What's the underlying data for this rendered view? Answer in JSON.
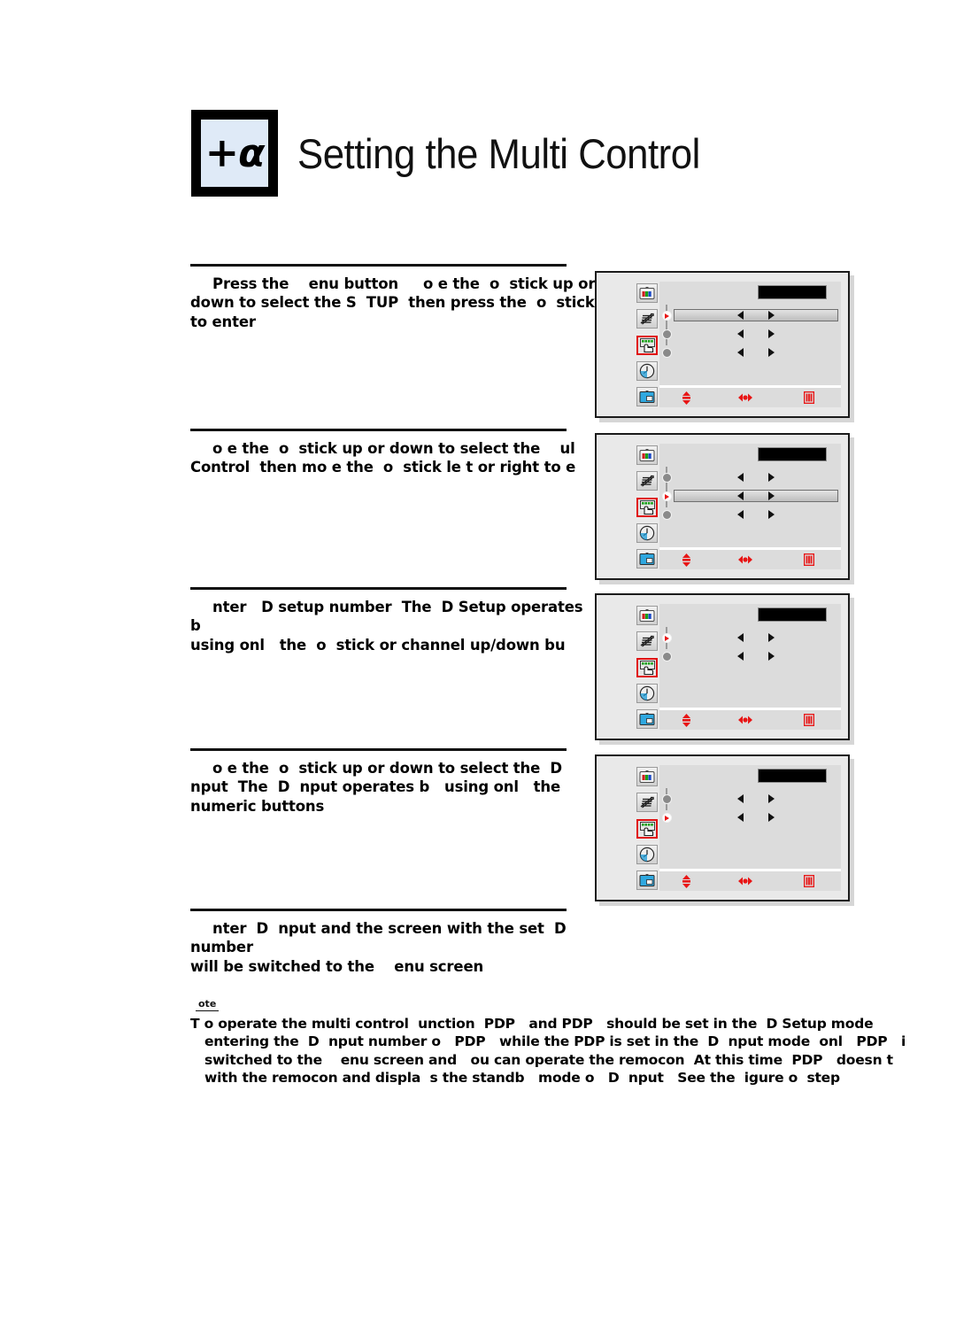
{
  "header": {
    "badge_plus": "+",
    "badge_alpha": "α",
    "title": "Setting the Multi Control"
  },
  "steps": [
    {
      "id": "step1",
      "line1": "Press the    enu button     o e the  o  stick up or",
      "line2": "down to select the S  TUP  then press the  o  stick",
      "line3": "to enter"
    },
    {
      "id": "step2",
      "line1": "o e the  o  stick up or down to select the    ul",
      "line2": "Control  then mo e the  o  stick le t or right to e",
      "line3": ""
    },
    {
      "id": "step3",
      "line1": "nter   D setup number  The  D Setup operates b",
      "line2": "using onl   the  o  stick or channel up/down bu",
      "line3": ""
    },
    {
      "id": "step4",
      "line1": "o e the  o  stick up or down to select the  D",
      "line2": "nput  The  D  nput operates b   using onl   the",
      "line3": "numeric buttons"
    },
    {
      "id": "step5",
      "line1": "nter  D  nput and the screen with the set  D number",
      "line2": "will be switched to the    enu screen",
      "line3": ""
    }
  ],
  "panels": [
    {
      "name": "panel1",
      "selected_icon_index": 2,
      "rows": [
        {
          "active": true,
          "bar": true,
          "connector": true
        },
        {
          "active": false,
          "bar": false,
          "connector": true
        },
        {
          "active": false,
          "bar": false,
          "connector": false
        }
      ]
    },
    {
      "name": "panel2",
      "selected_icon_index": 2,
      "rows": [
        {
          "active": false,
          "bar": false,
          "connector": true
        },
        {
          "active": true,
          "bar": true,
          "connector": true
        },
        {
          "active": false,
          "bar": false,
          "connector": false
        }
      ]
    },
    {
      "name": "panel3",
      "selected_icon_index": 2,
      "rows": [
        {
          "active": true,
          "bar": false,
          "connector": true
        },
        {
          "active": false,
          "bar": false,
          "connector": false
        }
      ]
    },
    {
      "name": "panel4",
      "selected_icon_index": 2,
      "rows": [
        {
          "active": false,
          "bar": false,
          "connector": true
        },
        {
          "active": true,
          "bar": false,
          "connector": false
        }
      ]
    }
  ],
  "osd_icons": [
    {
      "name": "picture-icon",
      "label": "Picture"
    },
    {
      "name": "sound-icon",
      "label": "Sound"
    },
    {
      "name": "setup-icon",
      "label": "Setup"
    },
    {
      "name": "time-icon",
      "label": "Time"
    },
    {
      "name": "pip-icon",
      "label": "PIP"
    }
  ],
  "osd_footer": [
    {
      "name": "move-updown-hint",
      "glyph": "updown"
    },
    {
      "name": "adjust-leftright-hint",
      "glyph": "leftright"
    },
    {
      "name": "exit-hint",
      "glyph": "exit"
    }
  ],
  "note": {
    "label": "ote",
    "line1": "T o operate the multi control  unction  PDP   and PDP   should be set in the  D Setup mode",
    "line2": "entering the  D  nput number o   PDP   while the PDP is set in the  D  nput mode  onl   PDP   i",
    "line3": "switched to the    enu screen and   ou can operate the remocon  At this time  PDP   doesn t",
    "line4": "with the remocon and displa  s the standb   mode o   D  nput   See the  igure o  step"
  },
  "colors": {
    "badge_fill": "#dfeaf7",
    "panel_bg": "#e9e9e9",
    "osd_bg": "#dcdcdc",
    "accent_red": "#e01010",
    "titlebar": "#000000"
  }
}
